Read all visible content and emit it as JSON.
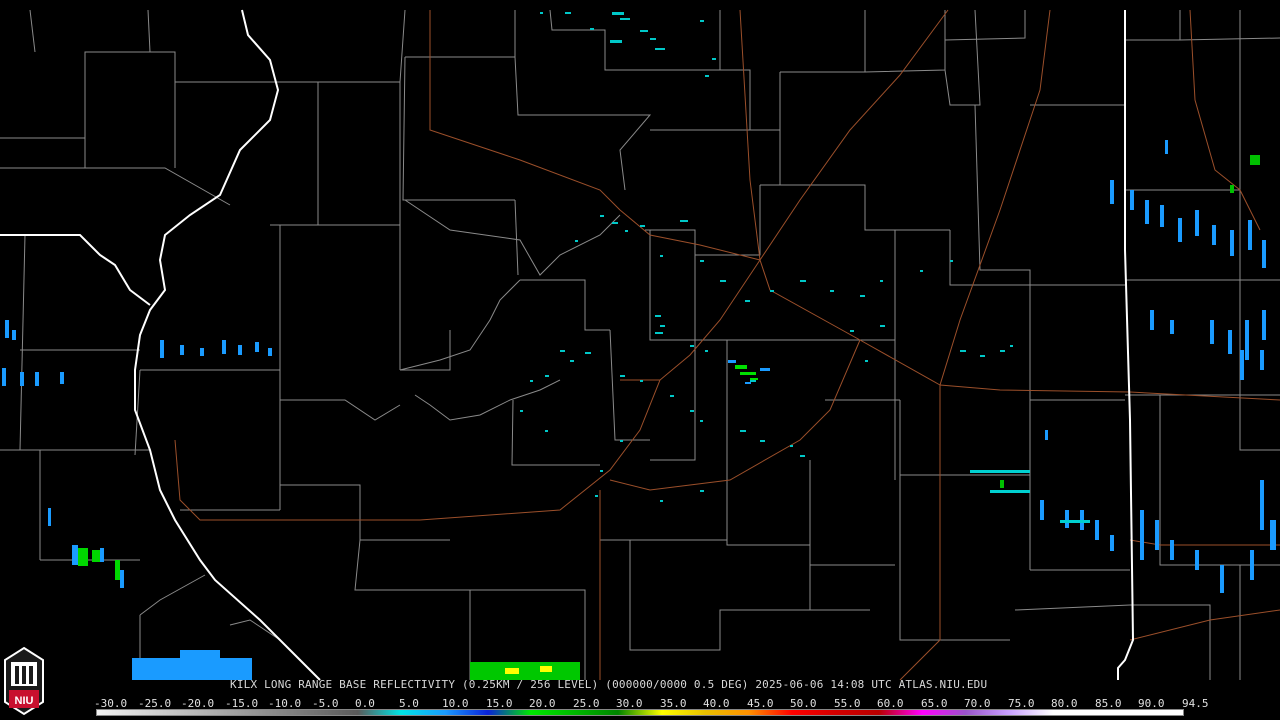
{
  "map": {
    "title": "KILX LONG RANGE BASE REFLECTIVITY (0.25KM / 256 LEVEL) (000000/0000 0.5 DEG) 2025-06-06 14:08 UTC  ATLAS.NIU.EDU",
    "logo_text": "NIU",
    "scale": [
      {
        "label": "-30.0",
        "color": "#f2f2f2"
      },
      {
        "label": "-25.0",
        "color": "#d8d8d8"
      },
      {
        "label": "-20.0",
        "color": "#bfbfbf"
      },
      {
        "label": "-15.0",
        "color": "#a5a5a5"
      },
      {
        "label": "-10.0",
        "color": "#8c8c8c"
      },
      {
        "label": "-5.0",
        "color": "#737373"
      },
      {
        "label": "0.0",
        "color": "#5a5a5a"
      },
      {
        "label": "5.0",
        "color": "#00e4e4"
      },
      {
        "label": "10.0",
        "color": "#1a9bff"
      },
      {
        "label": "15.0",
        "color": "#0a22d8"
      },
      {
        "label": "20.0",
        "color": "#00e800"
      },
      {
        "label": "25.0",
        "color": "#00b800"
      },
      {
        "label": "30.0",
        "color": "#008400"
      },
      {
        "label": "35.0",
        "color": "#ffff00"
      },
      {
        "label": "40.0",
        "color": "#e7c000"
      },
      {
        "label": "45.0",
        "color": "#ff9000"
      },
      {
        "label": "50.0",
        "color": "#ff0000"
      },
      {
        "label": "55.0",
        "color": "#d40000"
      },
      {
        "label": "60.0",
        "color": "#b80000"
      },
      {
        "label": "65.0",
        "color": "#ff00ff"
      },
      {
        "label": "70.0",
        "color": "#9955c9"
      },
      {
        "label": "75.0",
        "color": "#c8a0ff"
      },
      {
        "label": "80.0",
        "color": "#ffffff"
      },
      {
        "label": "85.0",
        "color": "#ffffff"
      },
      {
        "label": "90.0",
        "color": "#ffffff"
      },
      {
        "label": "94.5",
        "color": "#ffffff"
      }
    ]
  }
}
